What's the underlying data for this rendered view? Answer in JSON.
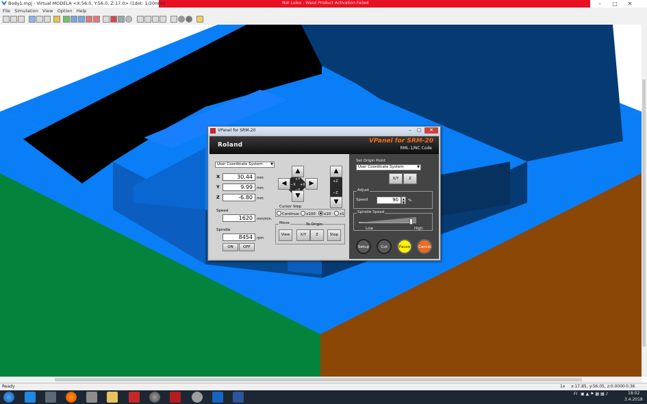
{
  "window": {
    "title": "Body1.mpj - Virtual MODELA <X:56.0, Y:56.0, Z:17.0> (1dot: 1/20mm)",
    "notice": "Not Lalex - Wasd Product Activation Failed"
  },
  "menu": [
    "File",
    "Simulation",
    "View",
    "Option",
    "Help"
  ],
  "colors": {
    "scene_blue": "#0a7ef6",
    "scene_navy": "#053a73",
    "scene_green": "#03833b",
    "scene_brown": "#8a4705",
    "accent_orange": "#f06a1c"
  },
  "vpanel": {
    "title": "VPanel for SRM-20",
    "brand": "Roland",
    "product": "VPanel for SRM-20",
    "subtitle": "RML-1/NC Code",
    "coord_system": "User Coordinate System",
    "axes": [
      {
        "label": "X",
        "value": "30.44",
        "unit": "mm"
      },
      {
        "label": "Y",
        "value": "9.99",
        "unit": "mm"
      },
      {
        "label": "Z",
        "value": "-6.80",
        "unit": "mm"
      }
    ],
    "jog": {
      "up": "+Y",
      "down": "−Y",
      "left": "−X",
      "right": "+X",
      "z_up": "+Z",
      "z_down": "−Z"
    },
    "speed": {
      "label": "Speed",
      "value": "1620",
      "unit": "mm/min."
    },
    "spindle": {
      "label": "Spindle",
      "value": "8454",
      "unit": "rpm",
      "on": "ON",
      "off": "OFF"
    },
    "cursor_step": {
      "label": "Cursor Step",
      "options": [
        "Continue",
        "x100",
        "x10",
        "x1"
      ],
      "selected": "x10"
    },
    "move": {
      "label": "Move",
      "to_origin": "To Origin",
      "view": "View",
      "xy": "X/Y",
      "z": "Z",
      "stop": "Stop"
    },
    "origin": {
      "label": "Set Origin Point",
      "system": "User Coordinate System",
      "xy": "X/Y",
      "z": "Z"
    },
    "adjust": {
      "label": "Adjust",
      "speed_label": "Speed",
      "speed_value": "90",
      "unit": "%"
    },
    "spindle_speed": {
      "label": "Spindle Speed",
      "low": "Low",
      "high": "High",
      "level": 0.9
    },
    "actions": {
      "setup": "Setup",
      "cut": "Cut",
      "pause": "Pause",
      "cancel": "Cancel"
    }
  },
  "status": {
    "left": "Ready",
    "zoom": "1x",
    "coords": "x:17.85, y:56.05, z:0.0000",
    "time": "0:36"
  },
  "taskbar": {
    "lang": "FI",
    "clock": "18:02",
    "date": "3.4.2018"
  }
}
